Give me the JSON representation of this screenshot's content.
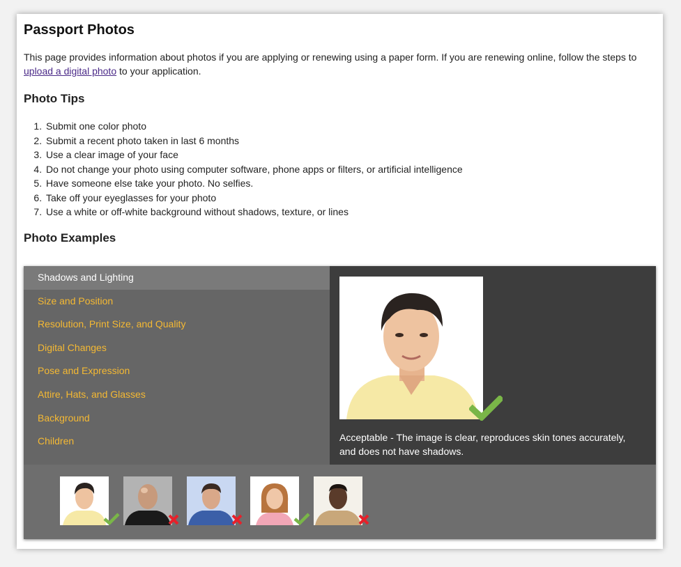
{
  "header": {
    "title": "Passport Photos",
    "intro_before": "This page provides information about photos if you are applying or renewing using a paper form. If you are renewing online, follow the steps to ",
    "intro_link": "upload a digital photo",
    "intro_after": " to your application."
  },
  "tips": {
    "heading": "Photo Tips",
    "items": [
      "Submit one color photo",
      "Submit a recent photo taken in last 6 months",
      "Use a clear image of your face",
      "Do not change your photo using computer software, phone apps or filters, or artificial intelligence",
      "Have someone else take your photo. No selfies.",
      "Take off your eyeglasses for your photo",
      "Use a white or off-white background without shadows, texture, or lines"
    ]
  },
  "examples": {
    "heading": "Photo Examples",
    "menu": [
      "Shadows and Lighting",
      "Size and Position",
      "Resolution, Print Size, and Quality",
      "Digital Changes",
      "Pose and Expression",
      "Attire, Hats, and Glasses",
      "Background",
      "Children"
    ],
    "active_index": 0,
    "caption": "Acceptable - The image is clear, reproduces skin tones accurately, and does not have shadows.",
    "main_status": "acceptable",
    "thumbnails": [
      {
        "status": "acceptable"
      },
      {
        "status": "unacceptable"
      },
      {
        "status": "unacceptable"
      },
      {
        "status": "acceptable"
      },
      {
        "status": "unacceptable"
      }
    ]
  },
  "colors": {
    "link": "#4b2a88",
    "menu_text": "#f5b933",
    "menu_bg": "#666666",
    "viewer_bg": "#3d3d3d",
    "accept": "#7ab648",
    "reject": "#e8202a"
  },
  "icons": {
    "accept": "check-icon",
    "reject": "x-icon"
  }
}
